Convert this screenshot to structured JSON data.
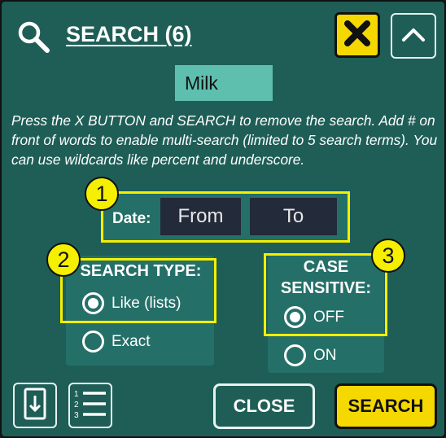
{
  "header": {
    "title": "SEARCH (6)",
    "close_icon": "x-icon",
    "collapse_icon": "chevron-up-icon",
    "search_icon": "search-icon"
  },
  "search": {
    "value": "Milk"
  },
  "help_text": "Press the X BUTTON and SEARCH to remove the search. Add # on front of words to enable multi-search (limited to 5 search terms). You can use wildcards like percent and underscore.",
  "date": {
    "label": "Date:",
    "from_label": "From",
    "to_label": "To"
  },
  "search_type": {
    "title": "SEARCH TYPE:",
    "options": [
      {
        "label": "Like (lists)",
        "selected": true
      },
      {
        "label": "Exact",
        "selected": false
      }
    ]
  },
  "case_sensitive": {
    "title": "CASE SENSITIVE:",
    "options": [
      {
        "label": "OFF",
        "selected": true
      },
      {
        "label": "ON",
        "selected": false
      }
    ]
  },
  "markers": [
    "1",
    "2",
    "3"
  ],
  "footer": {
    "export_icon": "export-icon",
    "list_icon": "numbered-list-icon",
    "close_label": "CLOSE",
    "search_label": "SEARCH"
  },
  "colors": {
    "background": "#1e5e56",
    "panel": "#247068",
    "input": "#5fbfae",
    "highlight": "#f5ef00",
    "primary_button": "#f5d800",
    "date_button": "#232a3a"
  }
}
